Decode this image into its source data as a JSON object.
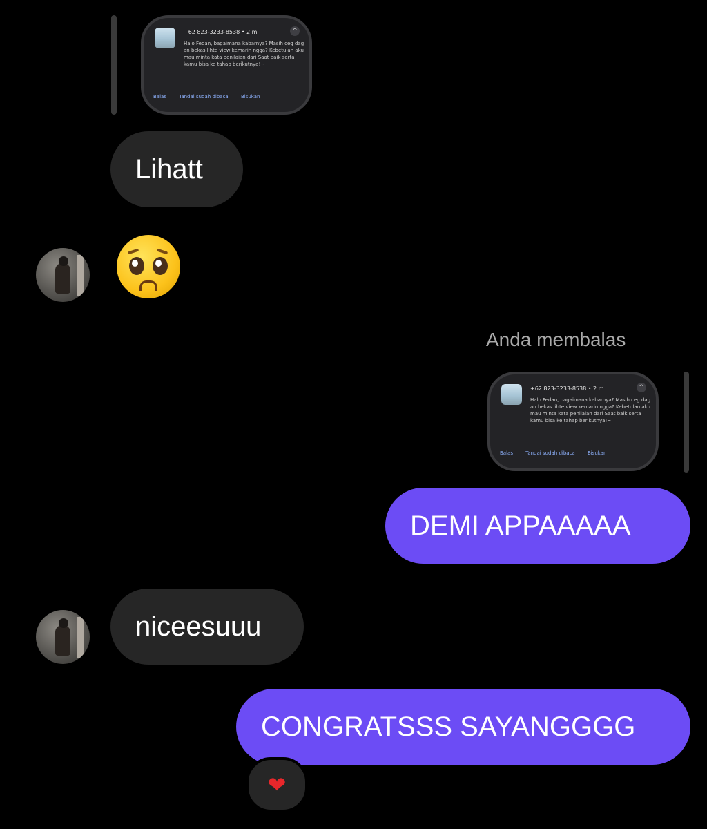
{
  "messages": {
    "shared_screenshot_1": {
      "sender": "+62 823-3233-8538",
      "time": "2 m",
      "body": "Halo Fedan, bagaimana kabarnya? Masih ceg dag an bekas lihte view kemarin ngga? Kebetulan aku mau minta kata penilaian dari Saat baik serta kamu bisa ke tahap berikutnya!~",
      "actions": [
        "Balas",
        "Tandai sudah dibaca",
        "Bisukan"
      ]
    },
    "msg_lihatt": "Lihatt",
    "msg_emoji": "pleading-face-emoji",
    "reply_label": "Anda membalas",
    "shared_screenshot_2": {
      "sender": "+62 823-3233-8538",
      "time": "2 m",
      "body": "Halo Fedan, bagaimana kabarnya? Masih ceg dag an bekas lihte view kemarin ngga? Kebetulan aku mau minta kata penilaian dari Saat baik serta kamu bisa ke tahap berikutnya!~",
      "actions": [
        "Balas",
        "Tandai sudah dibaca",
        "Bisukan"
      ]
    },
    "msg_demi": "DEMI APPAAAAA",
    "msg_nicee": "niceesuuu",
    "msg_congrats": "CONGRATSSS SAYANGGGG",
    "reaction": "❤"
  },
  "colors": {
    "background": "#000000",
    "incoming_bubble": "#262626",
    "outgoing_bubble": "#6c4cf5",
    "reply_label": "#a9a9a9",
    "reaction_heart": "#e8272b"
  },
  "icons": {
    "avatar": "user-avatar",
    "emoji": "pleading-face-emoji",
    "reaction": "heart-icon",
    "chevron": "chevron-up-icon"
  }
}
